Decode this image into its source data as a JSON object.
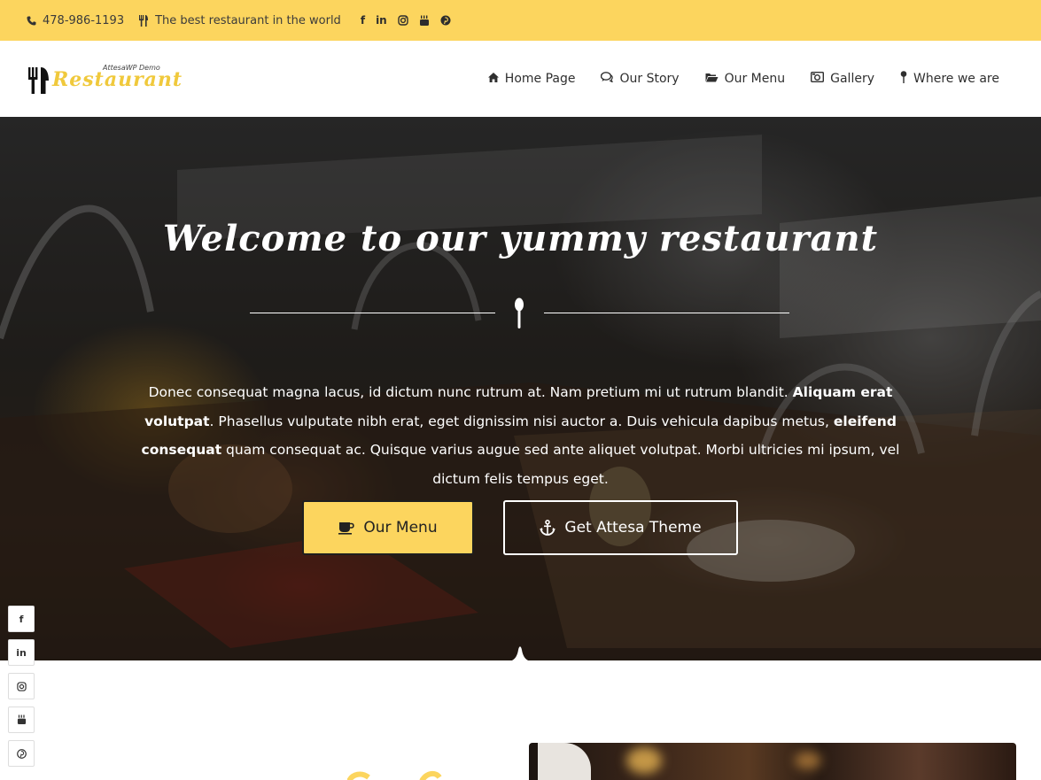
{
  "topbar": {
    "phone": "478-986-1193",
    "tagline": "The best restaurant in the world",
    "social": [
      "f",
      "in",
      "instagram",
      "youtube",
      "pinterest"
    ]
  },
  "logo": {
    "brand": "Restaurant",
    "small": "AttesaWP Demo"
  },
  "nav": {
    "items": [
      {
        "label": "Home Page",
        "icon": "home-icon"
      },
      {
        "label": "Our Story",
        "icon": "comments-icon"
      },
      {
        "label": "Our Menu",
        "icon": "folder-open-icon"
      },
      {
        "label": "Gallery",
        "icon": "camera-icon"
      },
      {
        "label": "Where we are",
        "icon": "map-pin-icon"
      }
    ]
  },
  "hero": {
    "title": "Welcome to our yummy  restaurant",
    "text_1": "Donec consequat magna lacus, id dictum nunc rutrum at. Nam pretium mi ut rutrum blandit. ",
    "bold_1": "Aliquam erat volutpat",
    "text_2": ". Phasellus vulputate nibh erat, eget dignissim nisi auctor a. Duis vehicula dapibus metus, ",
    "bold_2": "eleifend consequat",
    "text_3": " quam consequat ac. Quisque varius augue sed ante aliquet volutpat. Morbi ultricies mi ipsum, vel dictum felis tempus eget.",
    "button_menu": "Our Menu",
    "button_theme": "Get Attesa Theme"
  },
  "sidebar_social": [
    "f",
    "in",
    "ig",
    "yt",
    "p"
  ],
  "colors": {
    "accent": "#fcd55e",
    "dark": "#1e1e1e"
  }
}
